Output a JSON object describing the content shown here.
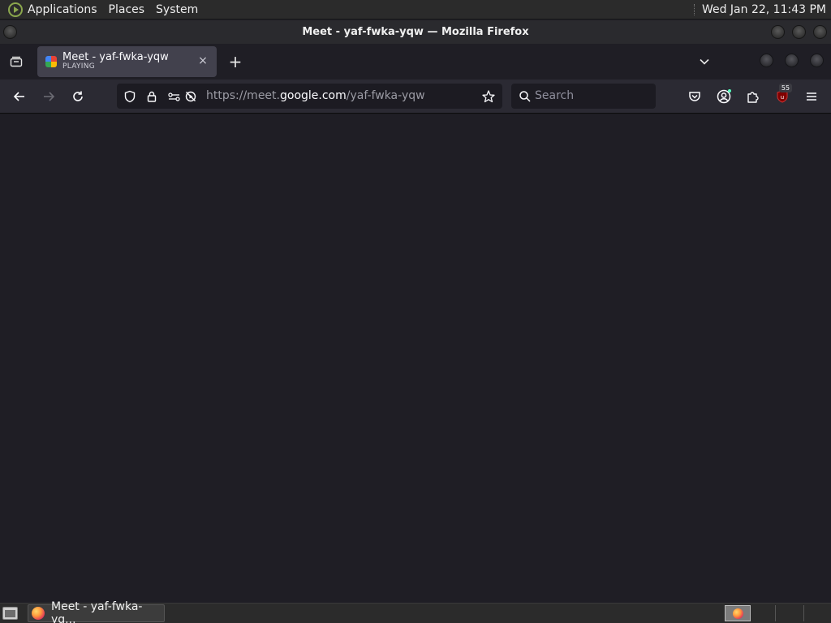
{
  "top_panel": {
    "menus": [
      "Applications",
      "Places",
      "System"
    ],
    "clock": "Wed Jan 22, 11:43 PM"
  },
  "window": {
    "title": "Meet - yaf-fwka-yqw — Mozilla Firefox"
  },
  "tab": {
    "title": "Meet - yaf-fwka-yqw",
    "subtitle": "PLAYING",
    "close_glyph": "×"
  },
  "tabstrip": {
    "new_tab_glyph": "+"
  },
  "urlbar": {
    "url_prefix": "https://meet.",
    "url_domain": "google.com",
    "url_path": "/yaf-fwka-yqw"
  },
  "searchbar": {
    "placeholder": "Search"
  },
  "toolbar": {
    "extension_badge": "55"
  },
  "taskbar": {
    "task_label": "Meet - yaf-fwka-yq..."
  },
  "colors": {
    "content_bg": "#1f1e25",
    "toolbar_bg": "#2b2a33",
    "tab_bg": "#42414d",
    "panel_bg": "#2b2b2b"
  }
}
